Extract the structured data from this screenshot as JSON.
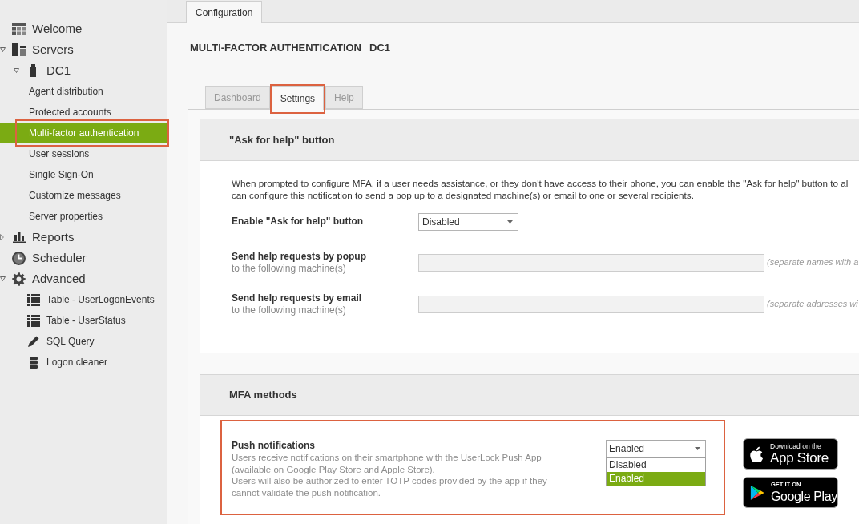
{
  "sidebar": {
    "items": [
      {
        "label": "Welcome",
        "selected": false
      },
      {
        "label": "Servers",
        "expanded": true,
        "selected": false,
        "children": [
          {
            "label": "DC1",
            "expanded": true,
            "selected": false,
            "children": [
              {
                "label": "Agent distribution",
                "selected": false,
                "highlighted": false
              },
              {
                "label": "Protected accounts",
                "selected": false,
                "highlighted": false
              },
              {
                "label": "Multi-factor authentication",
                "selected": true,
                "highlighted": true
              },
              {
                "label": "User sessions",
                "selected": false,
                "highlighted": false
              },
              {
                "label": "Single Sign-On",
                "selected": false,
                "highlighted": false
              },
              {
                "label": "Customize messages",
                "selected": false,
                "highlighted": false
              },
              {
                "label": "Server properties",
                "selected": false,
                "highlighted": false
              }
            ]
          }
        ]
      },
      {
        "label": "Reports",
        "expanded": false,
        "selected": false
      },
      {
        "label": "Scheduler",
        "selected": false
      },
      {
        "label": "Advanced",
        "expanded": true,
        "selected": false,
        "children": [
          {
            "label": "Table - UserLogonEvents",
            "selected": false
          },
          {
            "label": "Table - UserStatus",
            "selected": false
          },
          {
            "label": "SQL Query",
            "selected": false
          },
          {
            "label": "Logon cleaner",
            "selected": false
          }
        ]
      }
    ]
  },
  "top_tabs": [
    {
      "label": "Configuration",
      "selected": true
    }
  ],
  "header": {
    "title": "MULTI-FACTOR AUTHENTICATION",
    "server": "DC1"
  },
  "tabs": [
    {
      "label": "Dashboard",
      "selected": false,
      "highlighted": false
    },
    {
      "label": "Settings",
      "selected": true,
      "highlighted": true
    },
    {
      "label": "Help",
      "selected": false,
      "highlighted": false
    }
  ],
  "ask_for_help": {
    "title": "\"Ask for help\" button",
    "description": "When prompted to configure MFA, if a user needs assistance, or they don't have access to their phone, you can enable the \"Ask for help\" button to al\ncan configure this notification to send a pop up to a designated machine(s) or email to one or several recipients.",
    "fields": [
      {
        "kind": "select",
        "label": "Enable \"Ask for help\" button",
        "value": "Disabled",
        "disabled": false
      },
      {
        "kind": "text",
        "label": "Send help requests by popup",
        "sublabel": "to the following machine(s)",
        "hint": "(separate names with a",
        "disabled": true
      },
      {
        "kind": "text",
        "label": "Send help requests by email",
        "sublabel": "to the following machine(s)",
        "hint": "(separate addresses wi",
        "disabled": true
      }
    ]
  },
  "mfa_methods": {
    "title": "MFA methods",
    "methods": [
      {
        "name": "Push notifications",
        "description": "Users receive notifications on their smartphone with the UserLock Push App\n(available on Google Play Store and Apple Store).\nUsers will also be authorized to enter TOTP codes provided by the app if they\ncannot validate the push notification.",
        "highlighted": true,
        "value": "Enabled",
        "expanded": true,
        "options": [
          {
            "label": "Disabled",
            "selected": false
          },
          {
            "label": "Enabled",
            "selected": true
          }
        ]
      }
    ],
    "store_badges": [
      {
        "kind": "apple",
        "caption": "Download on the",
        "label": "App Store"
      },
      {
        "kind": "google",
        "caption": "GET IT ON",
        "label": "Google Play"
      }
    ]
  }
}
